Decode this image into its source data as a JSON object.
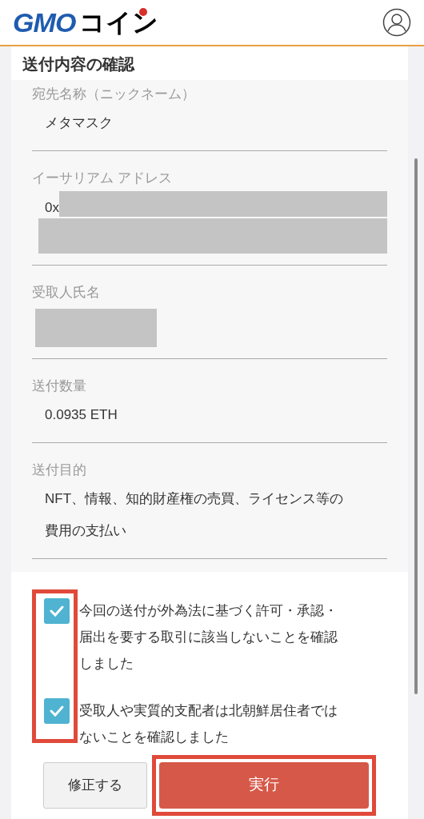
{
  "header": {
    "logo_latin": "GMO",
    "logo_kana": "コイン"
  },
  "title": "送付内容の確認",
  "fields": [
    {
      "kind": "text",
      "label": "宛先名称（ニックネーム）",
      "value": "メタマスク"
    },
    {
      "kind": "address",
      "label": "イーサリアム アドレス",
      "value": "0x"
    },
    {
      "kind": "redacted",
      "label": "受取人氏名"
    },
    {
      "kind": "text",
      "label": "送付数量",
      "value": "0.0935 ETH"
    },
    {
      "kind": "text",
      "label": "送付目的",
      "value": "NFT、情報、知的財産権の売買、ライセンス等の費用の支払い"
    }
  ],
  "confirmations": [
    {
      "checked": true,
      "text": "今回の送付が外為法に基づく許可・承認・届出を要する取引に該当しないことを確認しました"
    },
    {
      "checked": true,
      "text": "受取人や実質的支配者は北朝鮮居住者ではないことを確認しました"
    }
  ],
  "buttons": [
    {
      "kind": "secondary",
      "label": "修正する"
    },
    {
      "kind": "primary",
      "label": "実行"
    }
  ]
}
